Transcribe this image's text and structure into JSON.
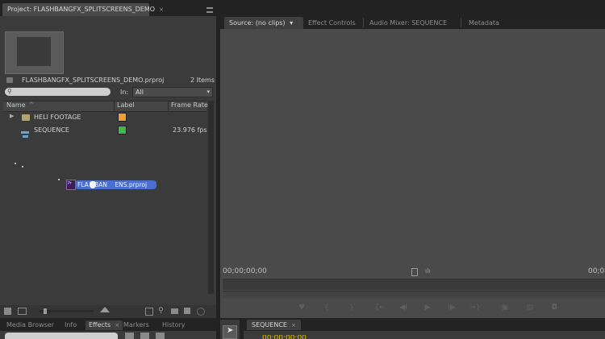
{
  "project_panel": {
    "tab_title": "Project: FLASHBANGFX_SPLITSCREENS_DEMO",
    "tab_close": "×",
    "file_name": "FLASHBANGFX_SPLITSCREENS_DEMO.prproj",
    "item_count": "2 Items",
    "search": {
      "placeholder": "",
      "in_label": "In:",
      "in_value": "All"
    },
    "columns": {
      "name": "Name",
      "label": "Label",
      "frame_rate": "Frame Rate"
    },
    "rows": [
      {
        "name": "HELI FOOTAGE",
        "label_color": "#f0a030",
        "frame_rate": "",
        "icon": "folder-icon"
      },
      {
        "name": "SEQUENCE",
        "label_color": "#3dbb4a",
        "frame_rate": "23.976 fps",
        "icon": "sequence-icon"
      }
    ],
    "drag_item": {
      "label": "FLA   BAN    ENS.prproj",
      "icon": "premiere-project-icon"
    }
  },
  "monitor_panel": {
    "tabs": [
      {
        "label": "Source: (no clips)",
        "active": true
      },
      {
        "label": "Effect Controls",
        "active": false
      },
      {
        "label": "Audio Mixer: SEQUENCE",
        "active": false
      },
      {
        "label": "Metadata",
        "active": false
      }
    ],
    "timecode_left": "00;00;00;00",
    "timecode_right": "00;0"
  },
  "bottom_left_tabs": [
    {
      "label": "Media Browser",
      "active": false
    },
    {
      "label": "Info",
      "active": false
    },
    {
      "label": "Effects",
      "active": true
    },
    {
      "label": "Markers",
      "active": false
    },
    {
      "label": "History",
      "active": false
    }
  ],
  "timeline_tab": {
    "label": "SEQUENCE",
    "close": "×"
  },
  "colors": {
    "accent_blue": "#4a6fd0",
    "label_orange": "#f0a030",
    "label_green": "#3dbb4a"
  }
}
